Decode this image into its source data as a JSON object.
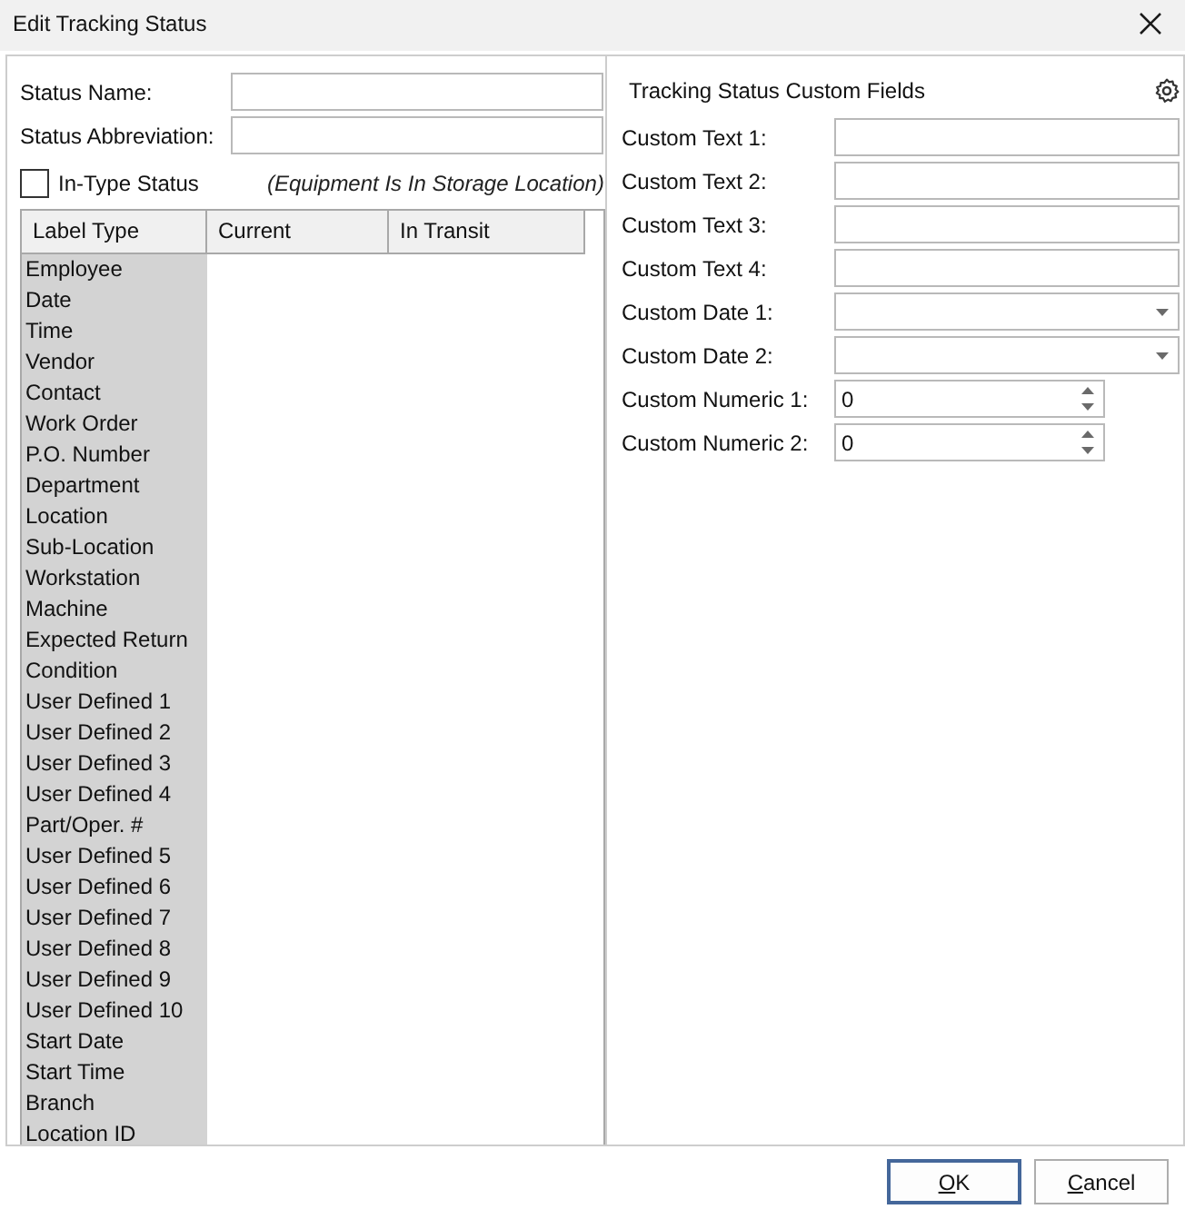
{
  "window": {
    "title": "Edit Tracking Status"
  },
  "status_form": {
    "fields": [
      {
        "label": "Status Name:"
      },
      {
        "label": "Status Abbreviation:"
      }
    ],
    "in_type": {
      "label": "In-Type Status",
      "checked": false,
      "note": "(Equipment Is In Storage Location)"
    }
  },
  "label_table": {
    "columns": [
      "Label Type",
      "Current",
      "In Transit"
    ],
    "rows": [
      "Employee",
      "Date",
      "Time",
      "Vendor",
      "Contact",
      "Work Order",
      "P.O. Number",
      "Department",
      "Location",
      "Sub-Location",
      "Workstation",
      "Machine",
      "Expected Return",
      "Condition",
      "User Defined 1",
      "User Defined 2",
      "User Defined 3",
      "User Defined 4",
      "Part/Oper. #",
      "User Defined 5",
      "User Defined 6",
      "User Defined 7",
      "User Defined 8",
      "User Defined 9",
      "User Defined 10",
      "Start Date",
      "Start Time",
      "Branch",
      "Location ID"
    ]
  },
  "custom_fields": {
    "title": "Tracking Status Custom Fields",
    "fields": [
      {
        "kind": "text",
        "label": "Custom Text 1:"
      },
      {
        "kind": "text",
        "label": "Custom Text 2:"
      },
      {
        "kind": "text",
        "label": "Custom Text 3:"
      },
      {
        "kind": "text",
        "label": "Custom Text 4:"
      },
      {
        "kind": "date",
        "label": "Custom Date 1:"
      },
      {
        "kind": "date",
        "label": "Custom Date 2:"
      },
      {
        "kind": "numeric",
        "label": "Custom Numeric 1:",
        "value": "0"
      },
      {
        "kind": "numeric",
        "label": "Custom Numeric 2:",
        "value": "0"
      }
    ]
  },
  "buttons": [
    {
      "label": "OK",
      "default": true,
      "access_key_underlined": true
    },
    {
      "label": "Cancel",
      "default": false,
      "access_key_underlined": true
    }
  ]
}
